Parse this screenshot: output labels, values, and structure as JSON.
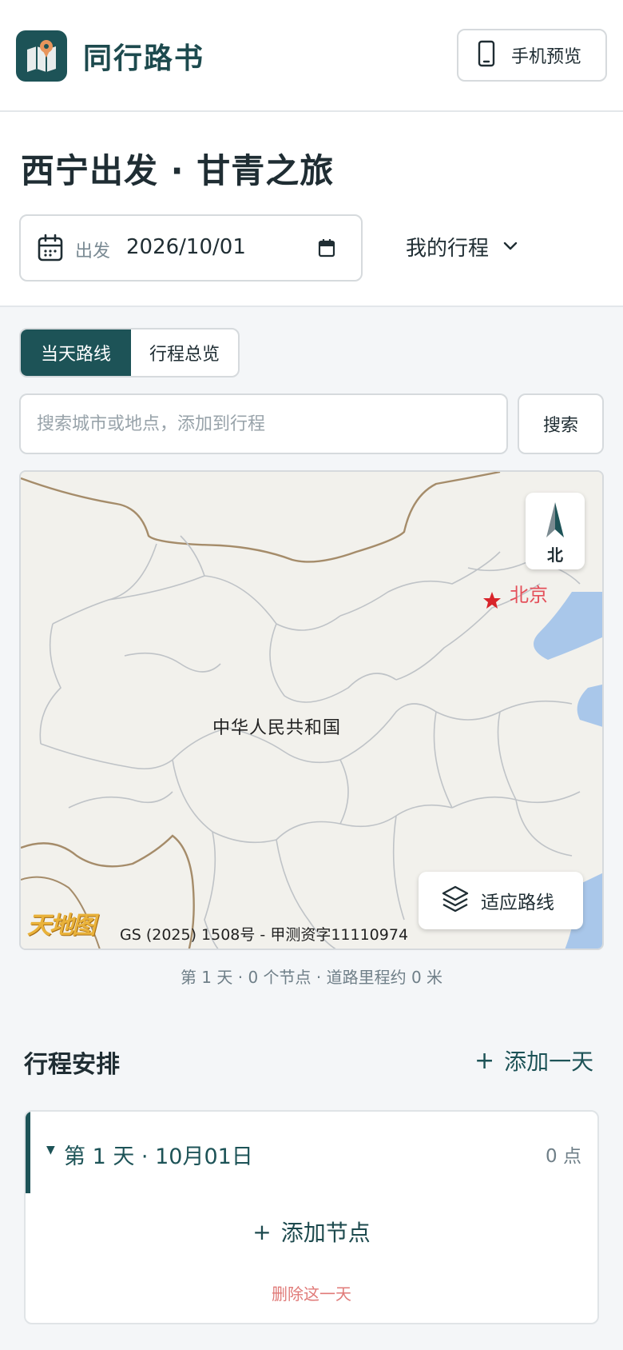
{
  "header": {
    "app_title": "同行路书",
    "preview_button": "手机预览"
  },
  "trip": {
    "title": "西宁出发 · 甘青之旅",
    "date_label": "出发",
    "date_value": "2026/10/01",
    "my_trips_label": "我的行程"
  },
  "tabs": [
    {
      "label": "当天路线",
      "active": true
    },
    {
      "label": "行程总览",
      "active": false
    }
  ],
  "search": {
    "placeholder": "搜索城市或地点，添加到行程",
    "button": "搜索"
  },
  "map": {
    "compass_label": "北",
    "city_label": "北京",
    "country_label": "中华人民共和国",
    "fit_button": "适应路线",
    "logo_text": "天地图",
    "credit": "GS (2025) 1508号 - 甲测资字11110974"
  },
  "route_info": "第 1 天 · 0 个节点 · 道路里程约 0 米",
  "schedule": {
    "title": "行程安排",
    "add_day": "添加一天",
    "days": [
      {
        "title": "第 1 天 · 10月01日",
        "count": "0 点",
        "add_node": "添加节点",
        "delete": "删除这一天"
      }
    ]
  },
  "colors": {
    "brand": "#1d5357",
    "danger": "#e07a78",
    "city": "#e4505a"
  }
}
